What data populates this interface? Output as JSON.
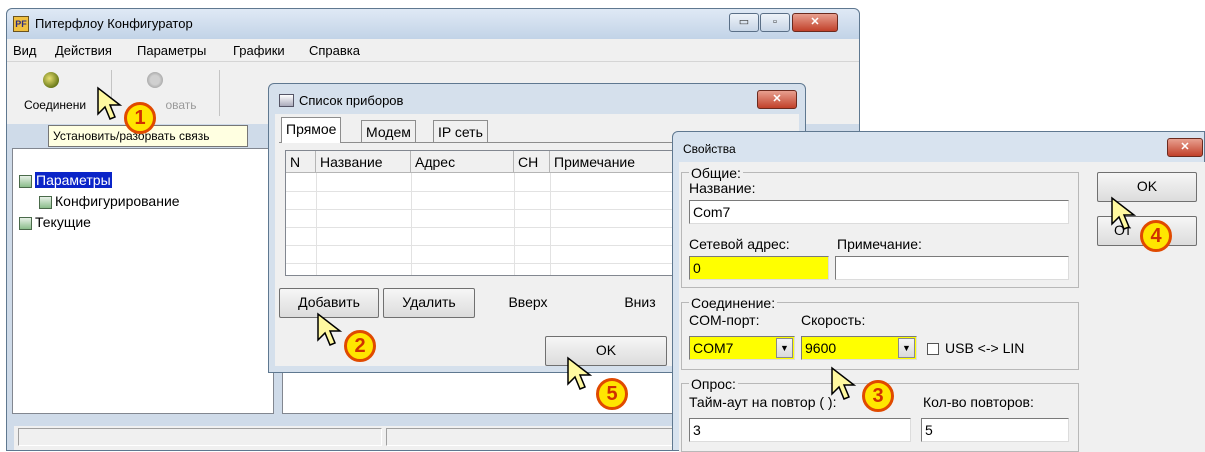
{
  "main_window": {
    "title": "Питерфлоу Конфигуратор",
    "app_icon_text": "PF",
    "minimize_label": "▭",
    "maximize_label": "▫",
    "close_label": "✕",
    "menu": [
      "Вид",
      "Действия",
      "Параметры",
      "Графики",
      "Справка"
    ],
    "toolbar": {
      "connect_label": "Соединени",
      "disconnect_label": "овать"
    },
    "tooltip": "Установить/разорвать связь",
    "tree": {
      "root": "Параметры",
      "child": "Конфигурирование",
      "second": "Текущие"
    }
  },
  "devices_dialog": {
    "title": "Список приборов",
    "close_label": "✕",
    "tabs": [
      "Прямое",
      "Модем",
      "IP сеть"
    ],
    "columns": [
      "N",
      "Название",
      "Адрес",
      "CH",
      "Примечание"
    ],
    "buttons": {
      "add": "Добавить",
      "delete": "Удалить",
      "up": "Вверх",
      "down": "Вниз",
      "ok": "OK"
    }
  },
  "properties_dialog": {
    "title": "Свойства",
    "close_label": "✕",
    "general": {
      "group_title": "Общие:",
      "name_label": "Название:",
      "name_value": "Com7",
      "address_label": "Сетевой адрес:",
      "address_value": "0",
      "note_label": "Примечание:",
      "note_value": ""
    },
    "connection": {
      "group_title": "Соединение:",
      "port_label": "COM-порт:",
      "port_value": "COM7",
      "speed_label": "Скорость:",
      "speed_value": "9600",
      "usb_label": "USB <-> LIN"
    },
    "polling": {
      "group_title": "Опрос:",
      "timeout_label": "Тайм-аут на повтор ( ):",
      "timeout_value": "3",
      "retries_label": "Кол-во повторов:",
      "retries_value": "5"
    },
    "ok": "OK",
    "cancel_partial": "От"
  },
  "callouts": [
    "1",
    "2",
    "3",
    "4",
    "5"
  ],
  "colors": {
    "highlight_field": "#ffff00",
    "selection": "#0a24c8",
    "callout_fill": "#ffe600",
    "callout_border": "#e04a00"
  }
}
